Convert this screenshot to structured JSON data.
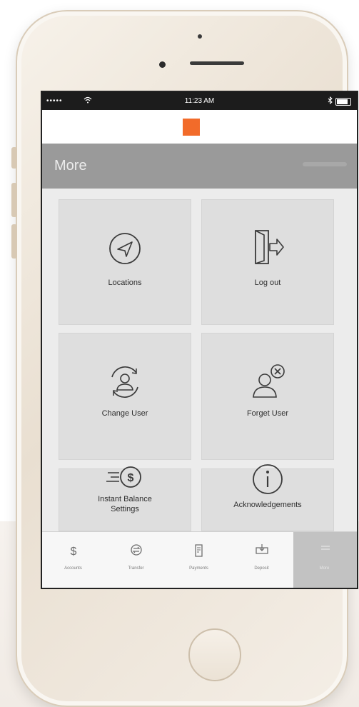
{
  "status_bar": {
    "carrier": "•••••",
    "wifi_icon": "wifi-icon",
    "time": "11:23 AM",
    "bluetooth_icon": "bluetooth-icon",
    "battery_level": 0.85
  },
  "header": {
    "logo_color": "#f26b2a"
  },
  "title_bar": {
    "title": "More"
  },
  "tiles": [
    {
      "label": "Locations",
      "icon": "location-arrow-icon"
    },
    {
      "label": "Log out",
      "icon": "door-exit-icon"
    },
    {
      "label": "Change User",
      "icon": "change-user-icon"
    },
    {
      "label": "Forget User",
      "icon": "forget-user-icon"
    },
    {
      "label": "Instant Balance Settings",
      "label_line1": "Instant Balance",
      "label_line2": "Settings",
      "icon": "instant-balance-icon"
    },
    {
      "label": "Acknowledgements",
      "icon": "info-icon"
    }
  ],
  "tabbar": {
    "tabs": [
      {
        "label": "Accounts",
        "icon": "dollar-icon"
      },
      {
        "label": "Transfer",
        "icon": "transfer-icon"
      },
      {
        "label": "Payments",
        "icon": "payments-icon"
      },
      {
        "label": "Deposit",
        "icon": "deposit-icon"
      },
      {
        "label": "More",
        "icon": "more-icon",
        "active": true
      }
    ]
  },
  "colors": {
    "brand": "#f26b2a",
    "title_bar": "#9a9a9a",
    "tile": "#dedede"
  }
}
